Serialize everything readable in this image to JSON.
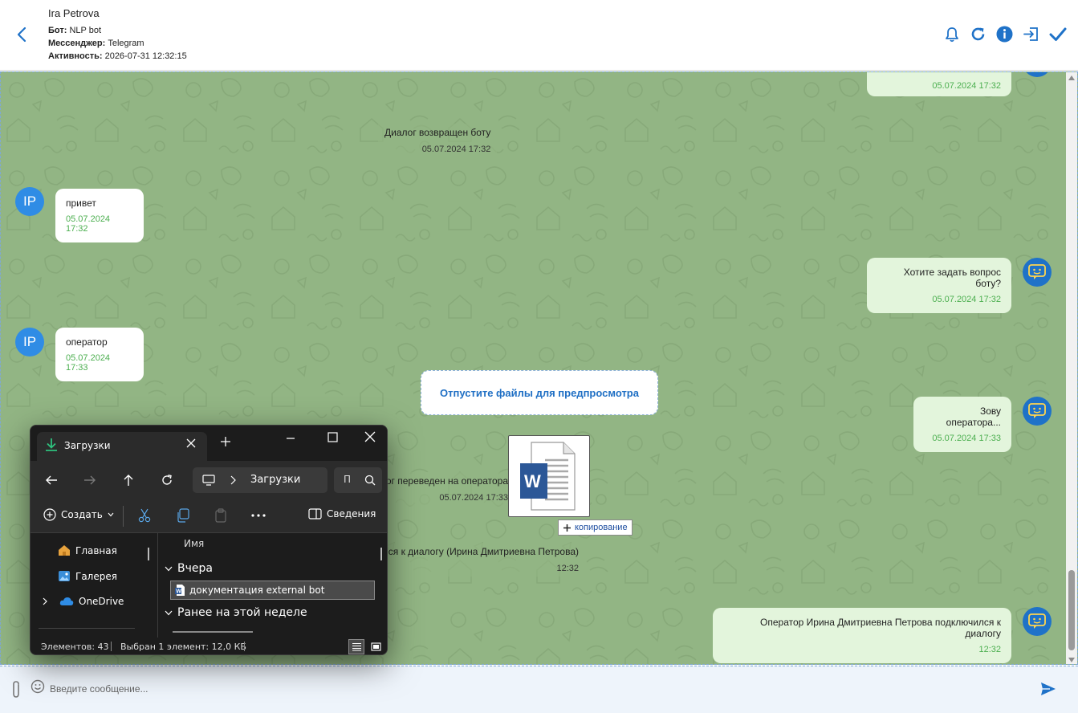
{
  "header": {
    "contact_name": "Ira Petrova",
    "bot_label": "Бот:",
    "bot_value": "NLP bot",
    "messenger_label": "Мессенджер:",
    "messenger_value": "Telegram",
    "activity_label": "Активность:",
    "activity_value": "2026-07-31 12:32:15",
    "actions": [
      "bell-icon",
      "refresh-icon",
      "info-icon",
      "sign-in-icon",
      "check-icon"
    ]
  },
  "colors": {
    "accent": "#1f72c8",
    "chat_bg": "#92b584",
    "incoming_bubble": "#ffffff",
    "outgoing_bubble": "#e3f5dc",
    "time_green": "#4caf50"
  },
  "messages": {
    "m0": {
      "time": "05.07.2024 17:32"
    },
    "m1": {
      "text": "Диалог возвращен боту",
      "time": "05.07.2024 17:32"
    },
    "m2": {
      "avatar": "IP",
      "text": "привет",
      "time": "05.07.2024 17:32"
    },
    "m3": {
      "text": "Хотите задать вопрос боту?",
      "time": "05.07.2024 17:32"
    },
    "m4": {
      "avatar": "IP",
      "text": "оператор",
      "time": "05.07.2024 17:33"
    },
    "m5": {
      "text": "Зову оператора...",
      "time": "05.07.2024 17:33"
    },
    "m6": {
      "text": "ог переведен на оператора",
      "time": "05.07.2024 17:33"
    },
    "m7": {
      "text": "ся к диалогу (Ирина Дмитриевна Петрова)",
      "time": "12:32"
    },
    "m8": {
      "text": "Оператор Ирина Дмитриевна Петрова подключился к диалогу",
      "time": "12:32"
    }
  },
  "drop_zone": {
    "label": "Отпустите файлы для предпросмотра"
  },
  "drag_file": {
    "letter": "W",
    "tooltip": "копирование"
  },
  "input": {
    "placeholder": "Введите сообщение..."
  },
  "explorer": {
    "tab_title": "Загрузки",
    "breadcrumb": "Загрузки",
    "search_hint": "П",
    "create_label": "Создать",
    "details_label": "Сведения",
    "sidebar": [
      {
        "label": "Главная",
        "icon": "home-icon"
      },
      {
        "label": "Галерея",
        "icon": "gallery-icon"
      },
      {
        "label": "OneDrive",
        "icon": "onedrive-icon"
      }
    ],
    "column_header": "Имя",
    "group_yesterday": "Вчера",
    "file_name": "документация external bot",
    "group_this_week": "Ранее на этой неделе",
    "status_count": "Элементов: 43",
    "status_selected": "Выбран 1 элемент: 12,0 КБ"
  }
}
